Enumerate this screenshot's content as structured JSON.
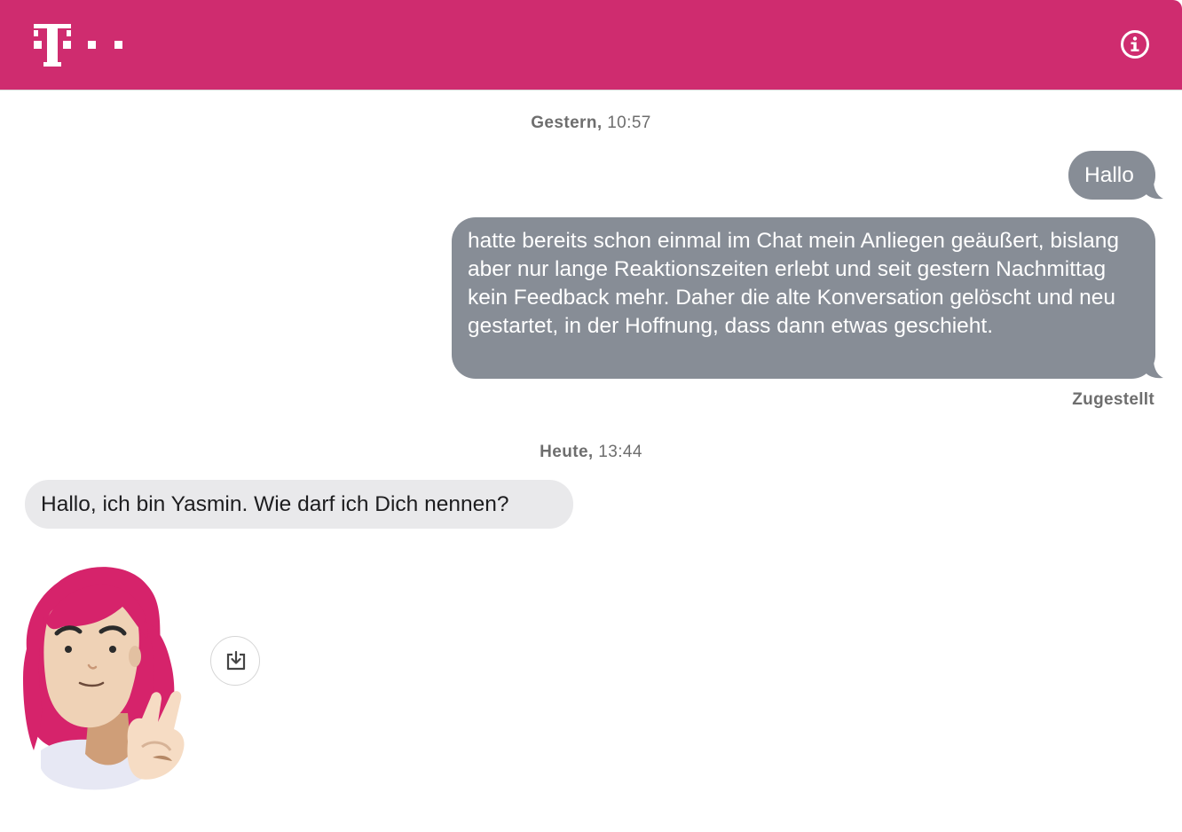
{
  "header": {
    "logo_icon": "telekom-logo-icon",
    "info_icon": "info-icon",
    "brand_color": "#cf2c6f"
  },
  "conversation": {
    "day1": {
      "date_label": "Gestern,",
      "time_label": "10:57"
    },
    "outgoing_messages": [
      {
        "text": "Hallo"
      },
      {
        "text": "hatte bereits schon einmal im Chat mein Anliegen geäußert, bislang aber nur lange Reaktionszeiten erlebt und seit gestern Nachmittag kein Feedback mehr. Daher die alte Konversation gelöscht und neu gestartet, in der Hoffnung, dass dann etwas geschieht."
      }
    ],
    "delivery_status": "Zugestellt",
    "day2": {
      "date_label": "Heute,",
      "time_label": "13:44"
    },
    "incoming_messages": [
      {
        "text": "Hallo, ich bin Yasmin. Wie darf ich Dich nennen?"
      }
    ],
    "sticker": {
      "icon": "yasmin-peace-sign-avatar",
      "download_icon": "download-icon"
    },
    "colors": {
      "outgoing_bubble": "#878d96",
      "incoming_bubble": "#e9e9eb"
    }
  }
}
